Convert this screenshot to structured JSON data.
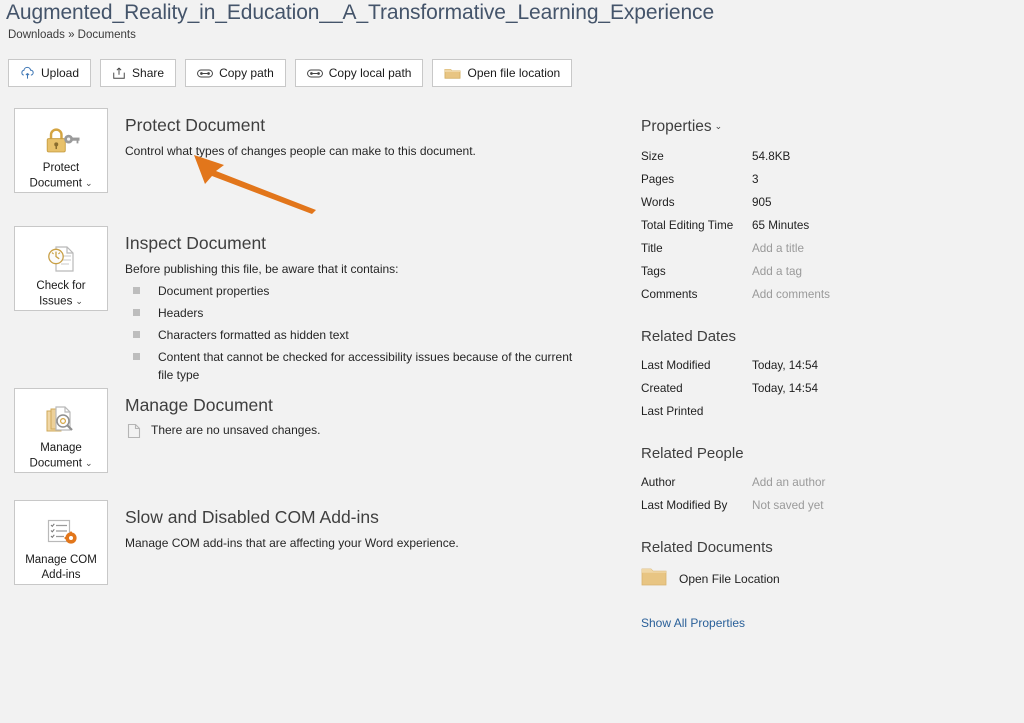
{
  "header": {
    "document_title": "Augmented_Reality_in_Education__A_Transformative_Learning_Experience",
    "breadcrumb": "Downloads » Documents",
    "title_color": "#44546a"
  },
  "toolbar": {
    "buttons": [
      {
        "label": "Upload",
        "icon": "cloud-upload-icon"
      },
      {
        "label": "Share",
        "icon": "share-icon"
      },
      {
        "label": "Copy path",
        "icon": "link-icon"
      },
      {
        "label": "Copy local path",
        "icon": "link-icon"
      },
      {
        "label": "Open file location",
        "icon": "folder-icon"
      }
    ]
  },
  "sections": [
    {
      "button_label_line1": "Protect",
      "button_label_line2": "Document",
      "button_has_chevron": true,
      "icon": "lock-key-icon",
      "title": "Protect Document",
      "description": "Control what types of changes people can make to this document."
    },
    {
      "button_label_line1": "Check for",
      "button_label_line2": "Issues",
      "button_has_chevron": true,
      "icon": "document-inspect-icon",
      "title": "Inspect Document",
      "description": "Before publishing this file, be aware that it contains:",
      "bullets": [
        "Document properties",
        "Headers",
        "Characters formatted as hidden text",
        "Content that cannot be checked for accessibility issues because of the current file type"
      ]
    },
    {
      "button_label_line1": "Manage",
      "button_label_line2": "Document",
      "button_has_chevron": true,
      "icon": "document-stack-search-icon",
      "title": "Manage Document",
      "note": "There are no unsaved changes.",
      "note_icon": "page-icon"
    },
    {
      "button_label_line1": "Manage COM",
      "button_label_line2": "Add-ins",
      "button_has_chevron": false,
      "icon": "checklist-gear-icon",
      "title": "Slow and Disabled COM Add-ins",
      "description": "Manage COM add-ins that are affecting your Word experience."
    }
  ],
  "properties": {
    "heading": "Properties",
    "heading_chevron": "⌄",
    "rows": [
      {
        "key": "Size",
        "value": "54.8KB",
        "placeholder": false
      },
      {
        "key": "Pages",
        "value": "3",
        "placeholder": false
      },
      {
        "key": "Words",
        "value": "905",
        "placeholder": false
      },
      {
        "key": "Total Editing Time",
        "value": "65 Minutes",
        "placeholder": false
      },
      {
        "key": "Title",
        "value": "Add a title",
        "placeholder": true
      },
      {
        "key": "Tags",
        "value": "Add a tag",
        "placeholder": true
      },
      {
        "key": "Comments",
        "value": "Add comments",
        "placeholder": true
      }
    ]
  },
  "related_dates": {
    "heading": "Related Dates",
    "rows": [
      {
        "key": "Last Modified",
        "value": "Today, 14:54"
      },
      {
        "key": "Created",
        "value": "Today, 14:54"
      },
      {
        "key": "Last Printed",
        "value": ""
      }
    ]
  },
  "related_people": {
    "heading": "Related People",
    "rows": [
      {
        "key": "Author",
        "value": "Add an author",
        "placeholder": true
      },
      {
        "key": "Last Modified By",
        "value": "Not saved yet",
        "placeholder": true
      }
    ]
  },
  "related_documents": {
    "heading": "Related Documents",
    "link_label": "Open File Location",
    "link_icon": "folder-icon",
    "show_all_label": "Show All Properties"
  },
  "annotation": {
    "type": "arrow",
    "color": "#e2761b",
    "points_to": "Control what types of changes people can make to this document."
  }
}
